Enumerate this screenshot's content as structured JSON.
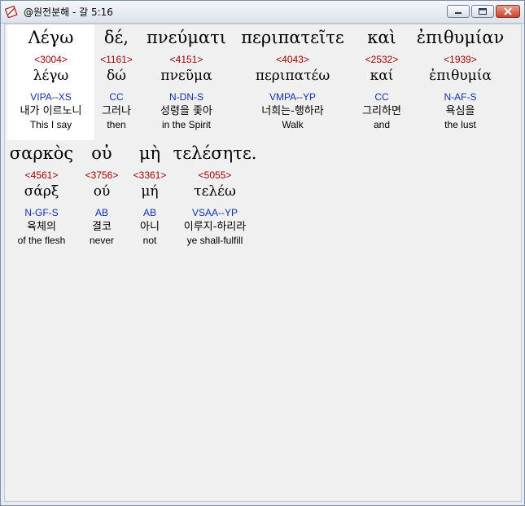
{
  "window": {
    "title": "@원전분해 - 갈 5:16"
  },
  "row1": [
    {
      "greek": "Λέγω",
      "strong": "<3004>",
      "lemma": "λέγω",
      "parse": "VIPA--XS",
      "korean": "내가 이르노니",
      "english": "This I say"
    },
    {
      "greek": "δέ,",
      "strong": "<1161>",
      "lemma": "δώ",
      "parse": "CC",
      "korean": "그러나",
      "english": "then"
    },
    {
      "greek": "πνεύματι",
      "strong": "<4151>",
      "lemma": "πνεῦμα",
      "parse": "N-DN-S",
      "korean": "성령을 좇아",
      "english": "in the Spirit"
    },
    {
      "greek": "περιπατεῖτε",
      "strong": "<4043>",
      "lemma": "περιπατέω",
      "parse": "VMPA--YP",
      "korean": "너희는-행하라",
      "english": "Walk"
    },
    {
      "greek": "καὶ",
      "strong": "<2532>",
      "lemma": "καί",
      "parse": "CC",
      "korean": "그리하면",
      "english": "and"
    },
    {
      "greek": "ἐπιθυμίαν",
      "strong": "<1939>",
      "lemma": "ἐπιθυμία",
      "parse": "N-AF-S",
      "korean": "욕심을",
      "english": "the lust"
    }
  ],
  "row2": [
    {
      "greek": "σαρκὸς",
      "strong": "<4561>",
      "lemma": "σάρξ",
      "parse": "N-GF-S",
      "korean": "육체의",
      "english": "of the flesh"
    },
    {
      "greek": "οὐ",
      "strong": "<3756>",
      "lemma": "ού",
      "parse": "AB",
      "korean": "결코",
      "english": "never"
    },
    {
      "greek": "μὴ",
      "strong": "<3361>",
      "lemma": "μή",
      "parse": "AB",
      "korean": "아니",
      "english": "not"
    },
    {
      "greek": "τελέσητε.",
      "strong": "<5055>",
      "lemma": "τελέω",
      "parse": "VSAA--YP",
      "korean": "이루지-하리라",
      "english": "ye shall-fulfill"
    }
  ],
  "colors": {
    "strong": "#a00000",
    "parse": "#1030b0",
    "selected_bg": "#ffffff",
    "client_bg": "#f0f0f0"
  },
  "icons": {
    "app": "bible-book-icon",
    "minimize": "minimize-icon",
    "maximize": "maximize-icon",
    "close": "close-icon"
  }
}
